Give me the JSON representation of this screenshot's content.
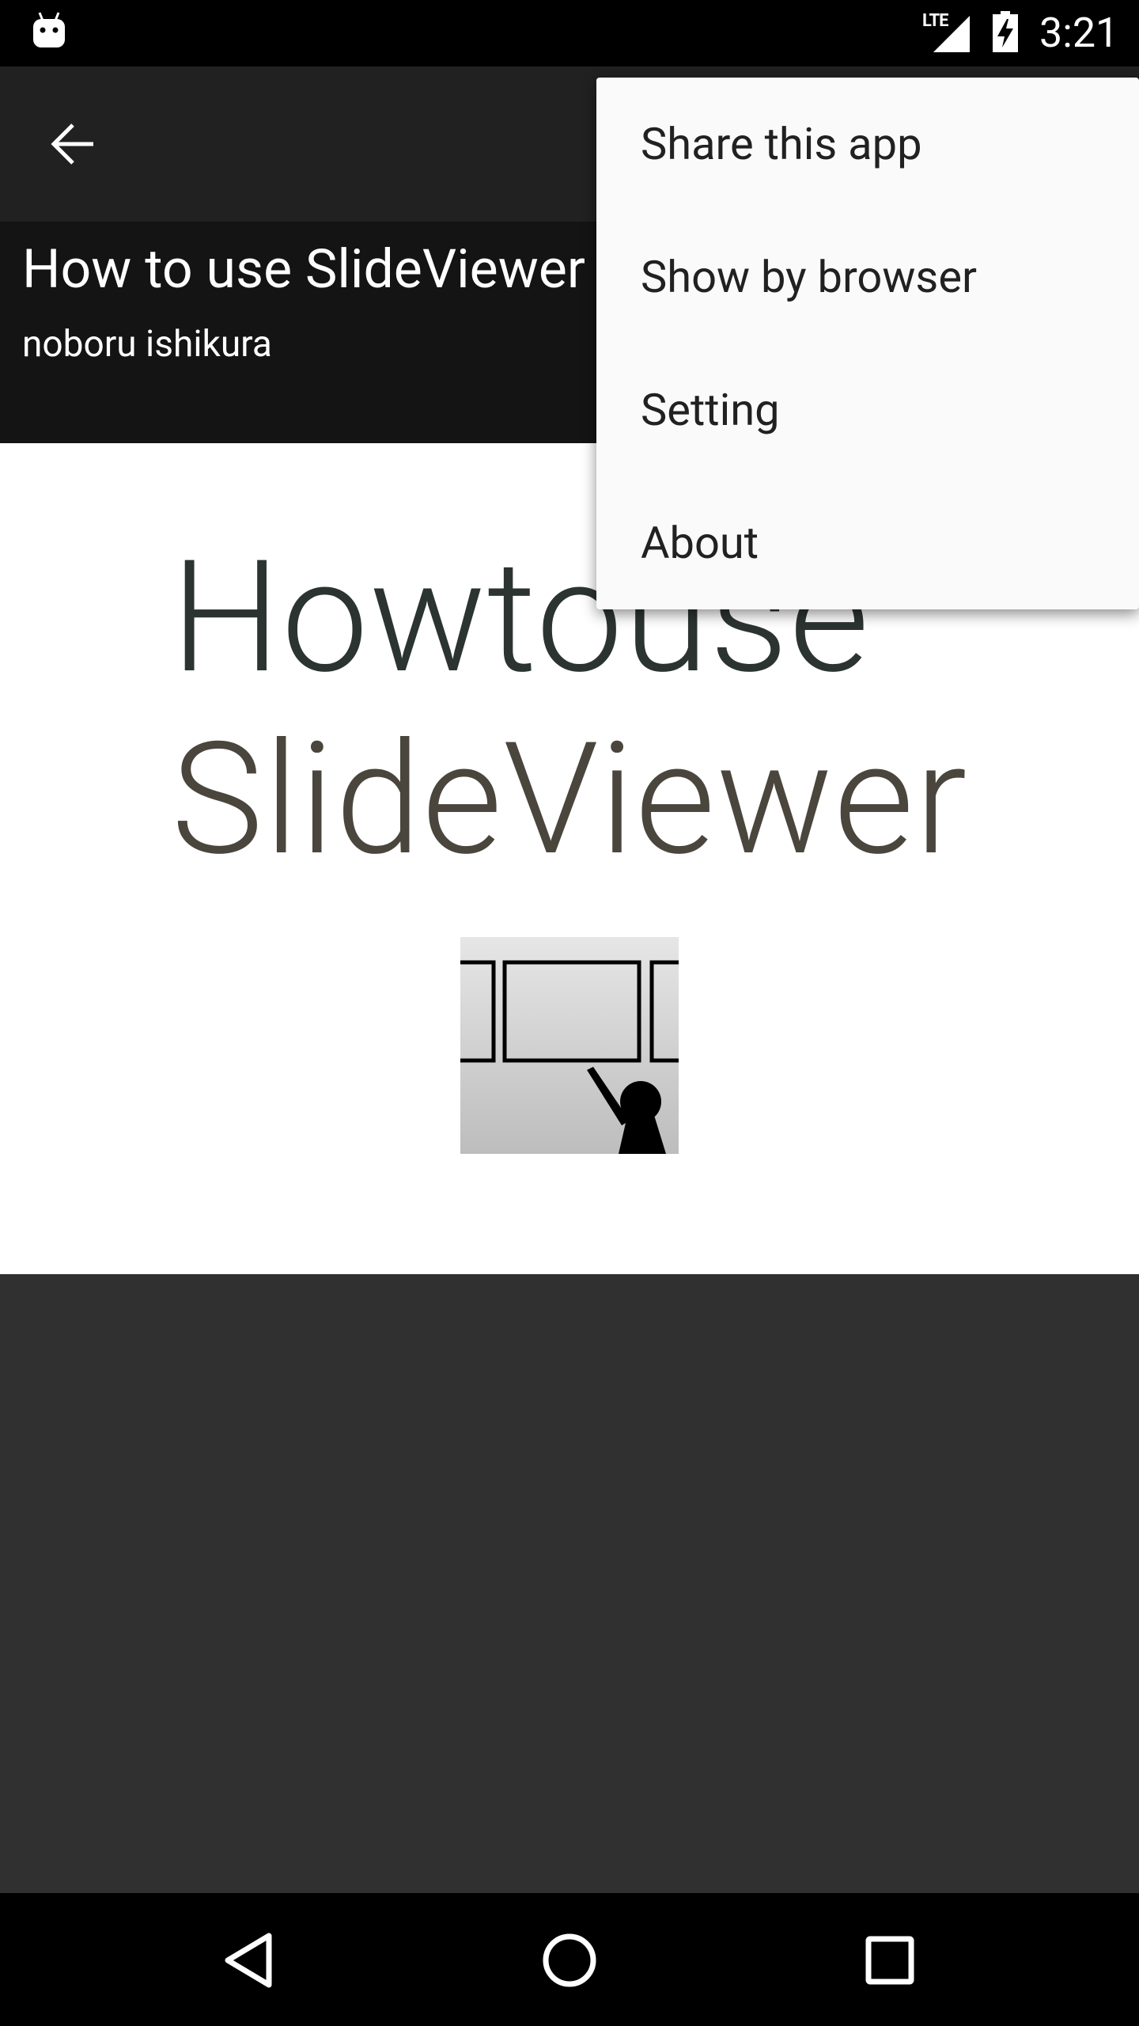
{
  "status_bar": {
    "network_label": "LTE",
    "time": "3:21"
  },
  "header": {
    "title": "How to use SlideViewer",
    "author": "noboru ishikura"
  },
  "slide": {
    "line1": "Howtouse",
    "line2": "SlideViewer"
  },
  "menu": {
    "items": [
      {
        "label": "Share this app"
      },
      {
        "label": "Show by browser"
      },
      {
        "label": "Setting"
      },
      {
        "label": "About"
      }
    ]
  },
  "icons": {
    "status": [
      "android-icon",
      "signal-icon",
      "battery-charging-icon"
    ],
    "toolbar": [
      "back-arrow-icon"
    ],
    "navigation": [
      "nav-back-icon",
      "nav-home-icon",
      "nav-recents-icon"
    ]
  },
  "colors": {
    "status_bar": "#000000",
    "toolbar": "#212121",
    "header": "#141414",
    "content_background": "#303030",
    "menu_background": "#fafafa"
  }
}
